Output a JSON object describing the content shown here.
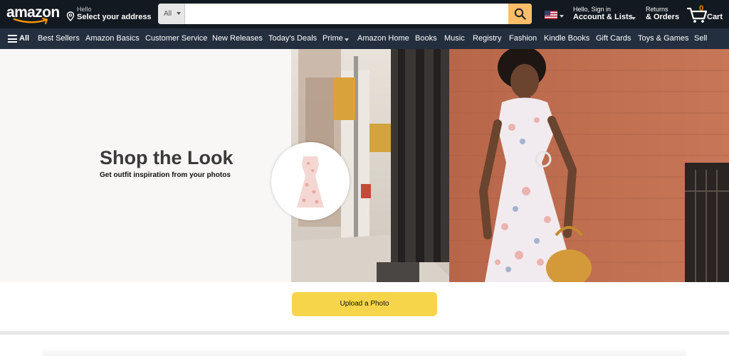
{
  "header": {
    "logo_text": "amazon",
    "address": {
      "hello": "Hello",
      "label": "Select your address"
    },
    "search": {
      "category": "All",
      "placeholder": "",
      "value": ""
    },
    "account": {
      "small": "Hello, Sign in",
      "main": "Account & Lists"
    },
    "returns": {
      "small": "Returns",
      "main": "& Orders"
    },
    "cart": {
      "count": "0",
      "label": "Cart"
    }
  },
  "subnav": {
    "all_label": "All",
    "items": [
      "Best Sellers",
      "Amazon Basics",
      "Customer Service",
      "New Releases",
      "Today's Deals",
      "Prime",
      "Amazon Home",
      "Books",
      "Music",
      "Registry",
      "Fashion",
      "Kindle Books",
      "Gift Cards",
      "Toys & Games",
      "Sell"
    ]
  },
  "hero": {
    "title": "Shop the Look",
    "subtitle": "Get outfit inspiration from your photos"
  },
  "upload": {
    "label": "Upload a Photo"
  },
  "colors": {
    "topbar": "#131921",
    "subnav": "#232f3e",
    "search_button": "#febd69",
    "upload_button": "#f7d54b",
    "cart_count": "#f08804"
  },
  "icons": {
    "location": "location-pin-icon",
    "search": "magnifier-icon",
    "flag": "us-flag-icon",
    "cart": "cart-icon",
    "menu": "hamburger-icon"
  }
}
